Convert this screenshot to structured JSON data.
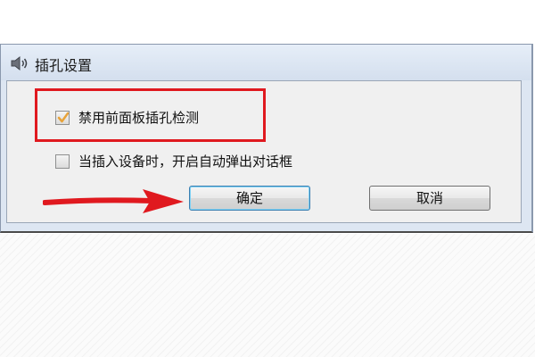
{
  "window": {
    "title": "插孔设置",
    "icon": "speaker-icon"
  },
  "options": [
    {
      "label": "禁用前面板插孔检测",
      "checked": true
    },
    {
      "label": "当插入设备时，开启自动弹出对话框",
      "checked": false
    }
  ],
  "buttons": {
    "ok_label": "确定",
    "cancel_label": "取消"
  },
  "colors": {
    "annotation": "#e0191f",
    "checkmark": "#e8a33a",
    "dialog_frame": "#dde6f2"
  }
}
